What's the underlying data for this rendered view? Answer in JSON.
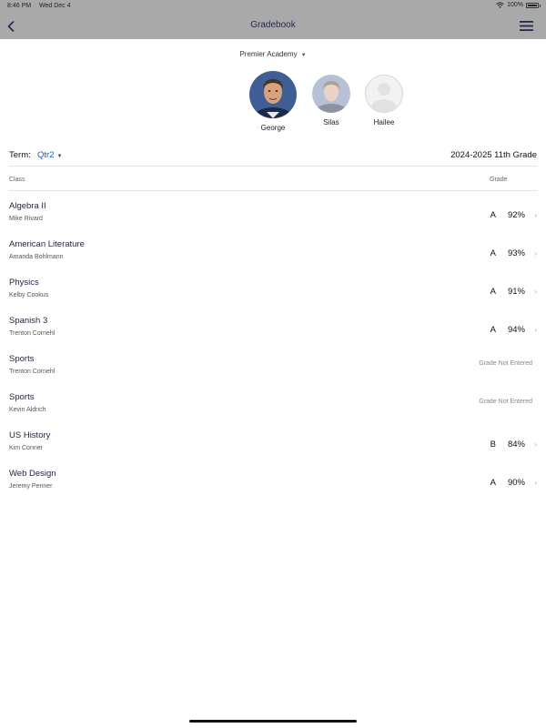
{
  "status_bar": {
    "time": "8:46 PM",
    "date": "Wed Dec 4",
    "battery": "100%"
  },
  "header": {
    "title": "Gradebook",
    "back_icon": "chevron-left-icon",
    "menu_icon": "hamburger-menu-icon"
  },
  "school": {
    "name": "Premier Academy"
  },
  "students": [
    {
      "name": "George",
      "selected": true
    },
    {
      "name": "Silas",
      "selected": false
    },
    {
      "name": "Hailee",
      "selected": false
    }
  ],
  "term": {
    "label": "Term:",
    "value": "Qtr2",
    "year_grade": "2024-2025 11th Grade"
  },
  "columns": {
    "class": "Class",
    "grade": "Grade"
  },
  "classes": [
    {
      "name": "Algebra II",
      "teacher": "Mike Rivard",
      "letter": "A",
      "percent": "92%",
      "status": ""
    },
    {
      "name": "American Literature",
      "teacher": "Amanda Bohlmann",
      "letter": "A",
      "percent": "93%",
      "status": ""
    },
    {
      "name": "Physics",
      "teacher": "Kelby Cookus",
      "letter": "A",
      "percent": "91%",
      "status": ""
    },
    {
      "name": "Spanish 3",
      "teacher": "Trenton Cornehl",
      "letter": "A",
      "percent": "94%",
      "status": ""
    },
    {
      "name": "Sports",
      "teacher": "Trenton Cornehl",
      "letter": "",
      "percent": "",
      "status": "Grade Not Entered"
    },
    {
      "name": "Sports",
      "teacher": "Kevin Aldrich",
      "letter": "",
      "percent": "",
      "status": "Grade Not Entered"
    },
    {
      "name": "US History",
      "teacher": "Kim Conner",
      "letter": "B",
      "percent": "84%",
      "status": ""
    },
    {
      "name": "Web Design",
      "teacher": "Jeremy Penner",
      "letter": "A",
      "percent": "90%",
      "status": ""
    }
  ],
  "colors": {
    "header_bg": "#a9a9a9",
    "accent": "#1a5fa8",
    "title": "#1f2a4d"
  }
}
